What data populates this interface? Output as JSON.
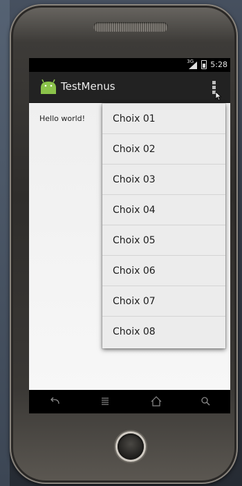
{
  "status_bar": {
    "network": "3G",
    "time": "5:28"
  },
  "action_bar": {
    "app_icon": "android-icon",
    "title": "TestMenus",
    "overflow_icon": "overflow-menu-icon"
  },
  "content": {
    "text": "Hello world!"
  },
  "menu": {
    "items": [
      {
        "label": "Choix 01"
      },
      {
        "label": "Choix 02"
      },
      {
        "label": "Choix 03"
      },
      {
        "label": "Choix 04"
      },
      {
        "label": "Choix 05"
      },
      {
        "label": "Choix 06"
      },
      {
        "label": "Choix 07"
      },
      {
        "label": "Choix 08"
      }
    ]
  },
  "nav_bar": {
    "buttons": [
      "back-icon",
      "menu-icon",
      "home-icon",
      "search-icon"
    ]
  },
  "colors": {
    "action_bar": "#222222",
    "content_bg": "#efefef",
    "menu_bg": "#ececec",
    "android_green": "#8bc34a"
  }
}
